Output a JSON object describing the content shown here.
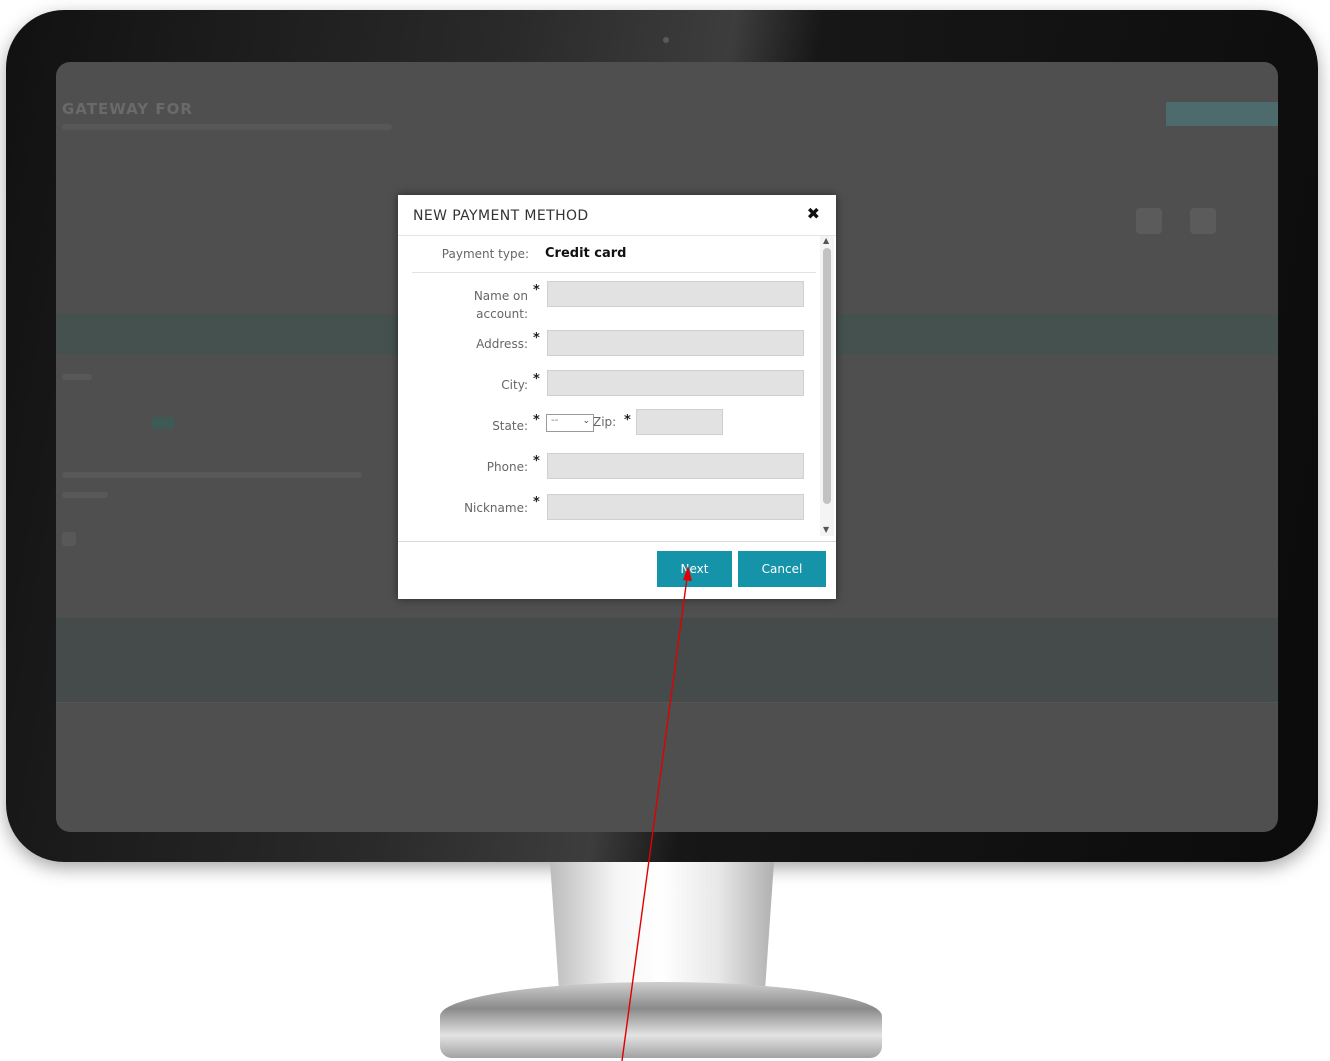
{
  "background_app": {
    "brand": "GATEWAY FOR"
  },
  "dialog": {
    "title": "NEW PAYMENT METHOD",
    "payment_type_label": "Payment type:",
    "payment_type_value": "Credit card",
    "fields": {
      "name_on_account_label_line1": "Name on",
      "name_on_account_label_line2": "account:",
      "address_label": "Address:",
      "city_label": "City:",
      "state_label": "State:",
      "state_value": "--",
      "zip_label": "Zip:",
      "phone_label": "Phone:",
      "nickname_label": "Nickname:",
      "required_marker": "*"
    },
    "buttons": {
      "next": "Next",
      "cancel": "Cancel"
    }
  },
  "colors": {
    "accent": "#1593a9",
    "annotation_arrow": "#e00000",
    "overlay": "#4f4f4f"
  },
  "icons": {
    "close": "close-icon",
    "select": "chevron-down-icon"
  }
}
